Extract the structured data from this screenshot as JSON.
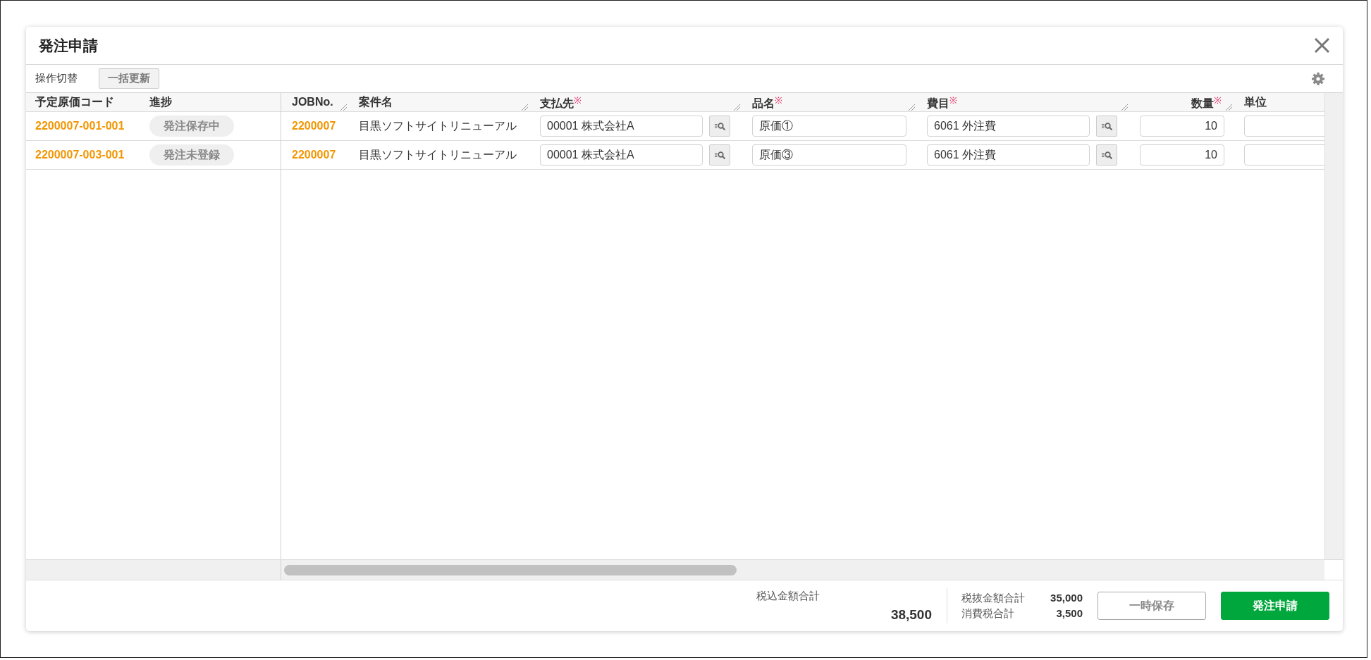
{
  "dialog": {
    "title": "発注申請"
  },
  "toolbar": {
    "label": "操作切替",
    "button": "一括更新"
  },
  "table": {
    "columns": [
      {
        "label": "予定原価コード",
        "resizable": false
      },
      {
        "label": "進捗",
        "resizable": false
      },
      {
        "label": "JOBNo.",
        "resizable": true
      },
      {
        "label": "案件名",
        "resizable": true
      },
      {
        "label": "支払先",
        "required_mark": "※",
        "resizable": true
      },
      {
        "label": "品名",
        "required_mark": "※",
        "resizable": true
      },
      {
        "label": "費目",
        "required_mark": "※",
        "resizable": true
      },
      {
        "label": "数量",
        "required_mark": "※",
        "resizable": true
      },
      {
        "label": "単位",
        "resizable": false
      }
    ],
    "rows": [
      {
        "cost_code": "2200007-001-001",
        "status": "発注保存中",
        "job_no": "2200007",
        "project_name": "目黒ソフトサイトリニューアル",
        "payee": "00001 株式会社A",
        "item_name": "原価①",
        "expense_item": "6061 外注費",
        "quantity": "10"
      },
      {
        "cost_code": "2200007-003-001",
        "status": "発注未登録",
        "job_no": "2200007",
        "project_name": "目黒ソフトサイトリニューアル",
        "payee": "00001 株式会社A",
        "item_name": "原価③",
        "expense_item": "6061 外注費",
        "quantity": "10"
      }
    ]
  },
  "footer": {
    "total": {
      "label": "税込金額合計",
      "value": "38,500"
    },
    "subtotals": [
      {
        "label": "税抜金額合計",
        "value": "35,000"
      },
      {
        "label": "消費税合計",
        "value": "3,500"
      }
    ],
    "buttons": [
      {
        "label": "一時保存",
        "kind": "secondary"
      },
      {
        "label": "発注申請",
        "kind": "primary"
      }
    ]
  }
}
